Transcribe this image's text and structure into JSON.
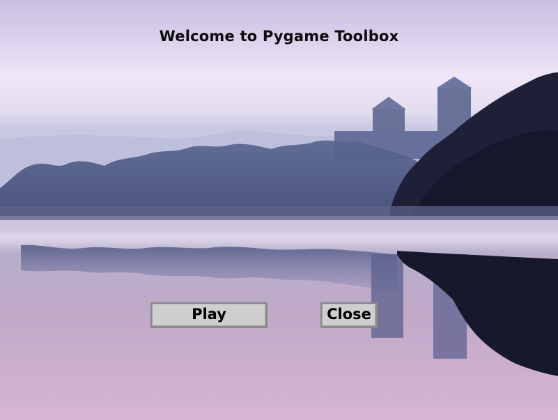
{
  "menu": {
    "title": "Welcome to Pygame Toolbox",
    "play_label": "Play",
    "close_label": "Close"
  },
  "colors": {
    "button_face": "#cfcfcf",
    "button_border": "#8a8a8a",
    "sky_top": "#cfc4e6",
    "water_bottom": "#cfaed0"
  }
}
